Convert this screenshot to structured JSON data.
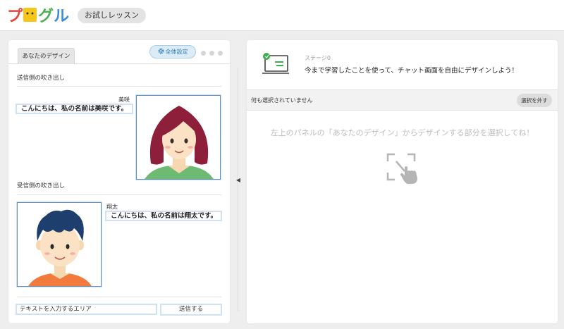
{
  "app": {
    "logo_text": "プログル",
    "lesson_label": "お試しレッスン"
  },
  "left_panel": {
    "tab_label": "あなたのデザイン",
    "global_settings_label": "全体設定",
    "sender_section_label": "送信側の吹き出し",
    "sender_name": "美咲",
    "sender_message": "こんにちは、私の名前は美咲です。",
    "receiver_section_label": "受信側の吹き出し",
    "receiver_name": "翔太",
    "receiver_message": "こんにちは、私の名前は翔太です。",
    "text_input_label": "テキストを入力するエリア",
    "send_label": "送信する"
  },
  "right_panel": {
    "stage_label": "ステージ0",
    "stage_description": "今まで学習したことを使って、チャット画面を自由にデザインしよう！",
    "selection_status": "何も選択されていません",
    "deselect_label": "選択を外す",
    "hint": "左上のパネルの「あなたのデザイン」からデザインする部分を選択してね！"
  },
  "colors": {
    "accent_blue": "#2a7cc0",
    "bubble_border": "#cfe2f3",
    "logo_red": "#e8453c",
    "logo_yellow": "#f5c518",
    "logo_green": "#4caf50",
    "logo_blue": "#3a8dde"
  }
}
